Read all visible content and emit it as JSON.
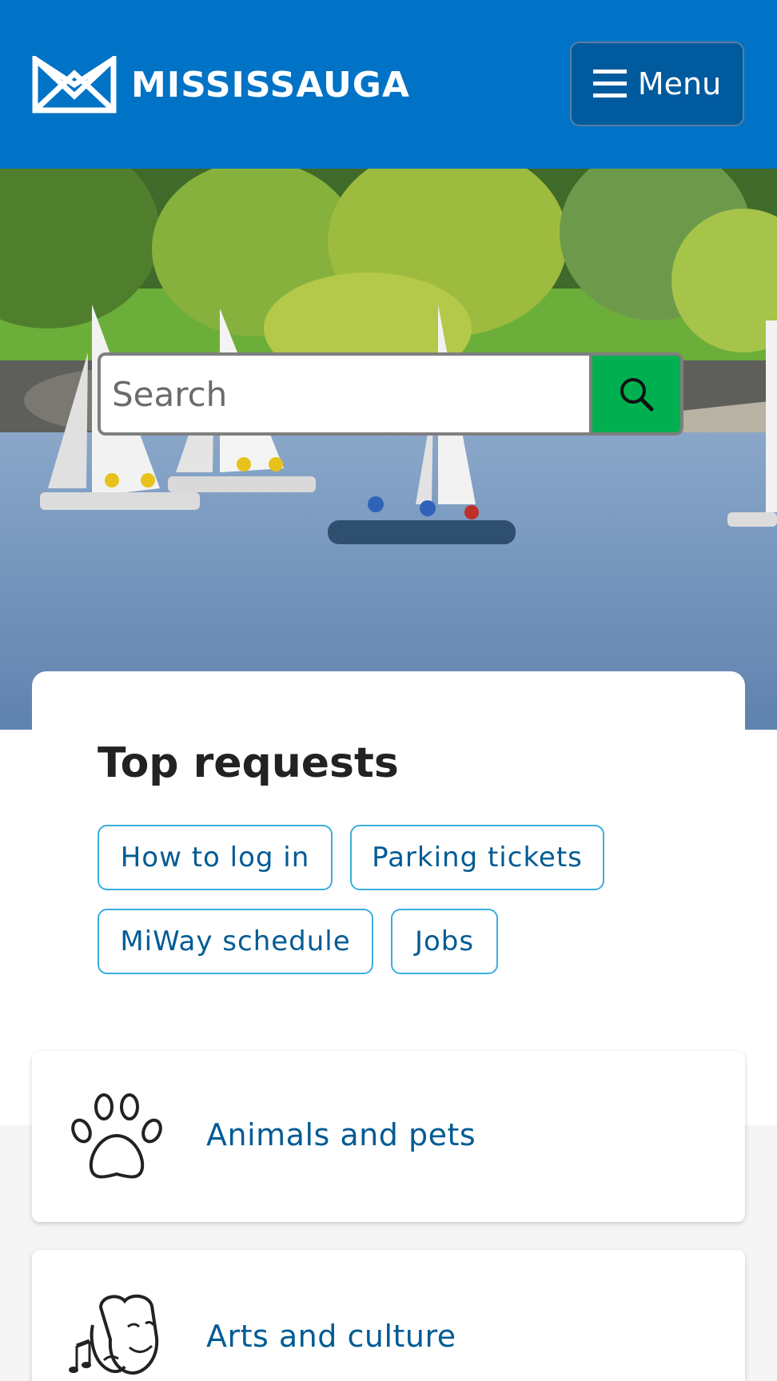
{
  "header": {
    "logo_text": "MISSISSAUGA",
    "menu_label": "Menu",
    "background_color": "#0073c6"
  },
  "search": {
    "placeholder": "Search",
    "button_color": "#00b050"
  },
  "top_requests": {
    "title": "Top requests",
    "items": [
      {
        "label": "How to log in"
      },
      {
        "label": "Parking tickets"
      },
      {
        "label": "MiWay schedule"
      },
      {
        "label": "Jobs"
      }
    ]
  },
  "categories": [
    {
      "label": "Animals and pets",
      "icon": "paw-icon"
    },
    {
      "label": "Arts and culture",
      "icon": "theatre-masks-icon"
    }
  ],
  "colors": {
    "link": "#005b94",
    "chip_border": "#3aaedf"
  }
}
